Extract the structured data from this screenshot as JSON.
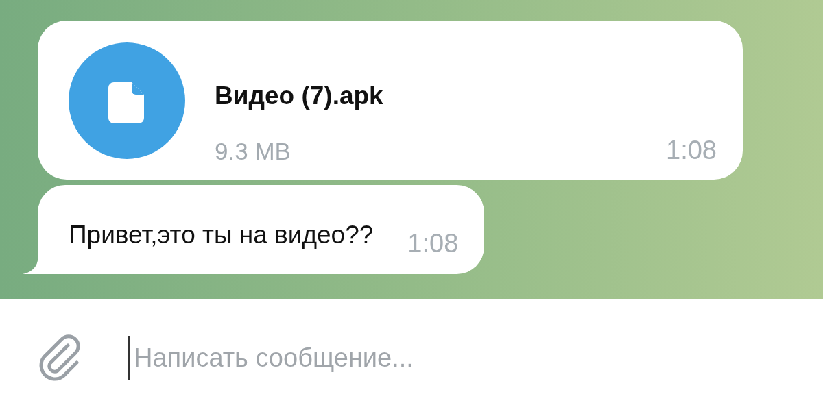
{
  "messages": [
    {
      "kind": "file",
      "file_name": "Видео (7).apk",
      "file_size": "9.3 MB",
      "time": "1:08"
    },
    {
      "kind": "text",
      "text": "Привет,это ты на видео??",
      "time": "1:08"
    }
  ],
  "composer": {
    "placeholder": "Написать сообщение..."
  }
}
